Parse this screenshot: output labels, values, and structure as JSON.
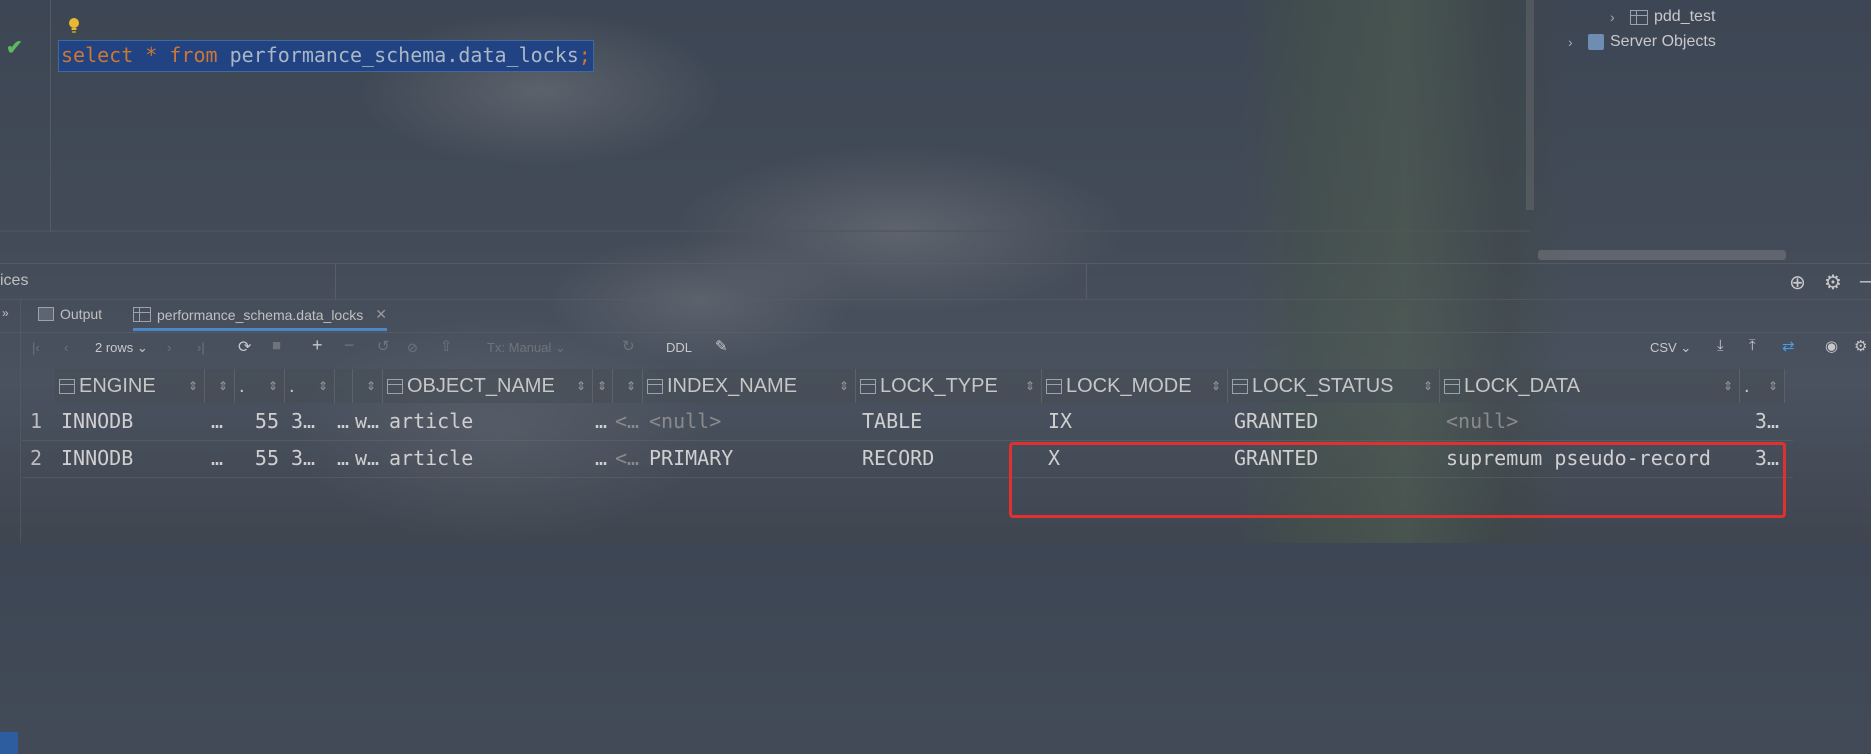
{
  "editor": {
    "sql": {
      "kw_select": "select",
      "star": " * ",
      "kw_from": "from",
      "table": " performance_schema.data_locks",
      "semicolon": ";"
    }
  },
  "tree": {
    "items": [
      {
        "label": "pdd_test",
        "icon": "table-icon"
      },
      {
        "label": "Server Objects",
        "icon": "server-objects-icon"
      }
    ]
  },
  "services": {
    "label": "ices"
  },
  "tabs": [
    {
      "label": "Output",
      "icon": "output-icon"
    },
    {
      "label": "performance_schema.data_locks",
      "icon": "table-icon",
      "active": true
    }
  ],
  "toolbar": {
    "rows": "2 rows",
    "tx": "Tx: Manual",
    "ddl": "DDL",
    "export": "CSV"
  },
  "grid": {
    "headers": [
      {
        "label": "ENGINE",
        "icon": true
      },
      {
        "label": "",
        "icon": false
      },
      {
        "label": ".",
        "icon": false
      },
      {
        "label": ".",
        "icon": false
      },
      {
        "label": "",
        "icon": false
      },
      {
        "label": "",
        "icon": false
      },
      {
        "label": "OBJECT_NAME",
        "icon": true
      },
      {
        "label": "",
        "icon": false
      },
      {
        "label": "",
        "icon": false
      },
      {
        "label": "INDEX_NAME",
        "icon": true
      },
      {
        "label": "LOCK_TYPE",
        "icon": true
      },
      {
        "label": "LOCK_MODE",
        "icon": true
      },
      {
        "label": "LOCK_STATUS",
        "icon": true
      },
      {
        "label": "LOCK_DATA",
        "icon": true
      },
      {
        "label": ".",
        "icon": false
      }
    ],
    "rows": [
      {
        "num": "1",
        "cells": [
          "INNODB",
          "…",
          "55",
          "3…",
          "…",
          "w…",
          "article",
          "…",
          "<…",
          "<null>",
          "TABLE",
          "IX",
          "GRANTED",
          "<null>",
          "3…"
        ]
      },
      {
        "num": "2",
        "cells": [
          "INNODB",
          "…",
          "55",
          "3…",
          "…",
          "w…",
          "article",
          "…",
          "<…",
          "PRIMARY",
          "RECORD",
          "X",
          "GRANTED",
          "supremum pseudo-record",
          "3…"
        ]
      }
    ]
  },
  "colors": {
    "selection": "#214283",
    "keyword": "#cc7832",
    "identifier": "#a9b7c6",
    "highlight_box": "#e03030",
    "accent": "#4a88c7"
  }
}
